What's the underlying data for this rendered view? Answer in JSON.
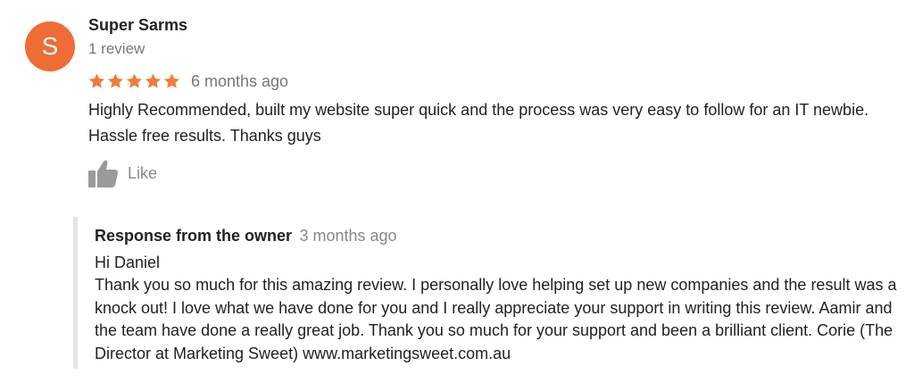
{
  "colors": {
    "avatar_bg": "#ef6c37",
    "star": "#ef7c3a",
    "meta_text": "#777777",
    "like_icon": "#9a9a9a",
    "response_border": "#e5e5e5"
  },
  "review": {
    "avatar_letter": "S",
    "reviewer_name": "Super Sarms",
    "review_count": "1 review",
    "rating": 5,
    "max_rating": 5,
    "time": "6 months ago",
    "text": "Highly Recommended,  built my website super quick and the process was very easy to follow for an IT newbie. Hassle free results. Thanks guys",
    "like_label": "Like",
    "icons": {
      "star": "star-icon",
      "like": "thumbs-up-icon"
    }
  },
  "owner_response": {
    "title": "Response from the owner",
    "time": "3 months ago",
    "greeting": "Hi Daniel",
    "text": "Thank you so much for this amazing review. I personally love helping set up new companies and the result was a knock out! I love what we have done for you and I really appreciate your support in writing this review. Aamir and the team have done a really great job. Thank you so much for your support and been a brilliant client. Corie (The Director at Marketing Sweet) www.marketingsweet.com.au"
  }
}
